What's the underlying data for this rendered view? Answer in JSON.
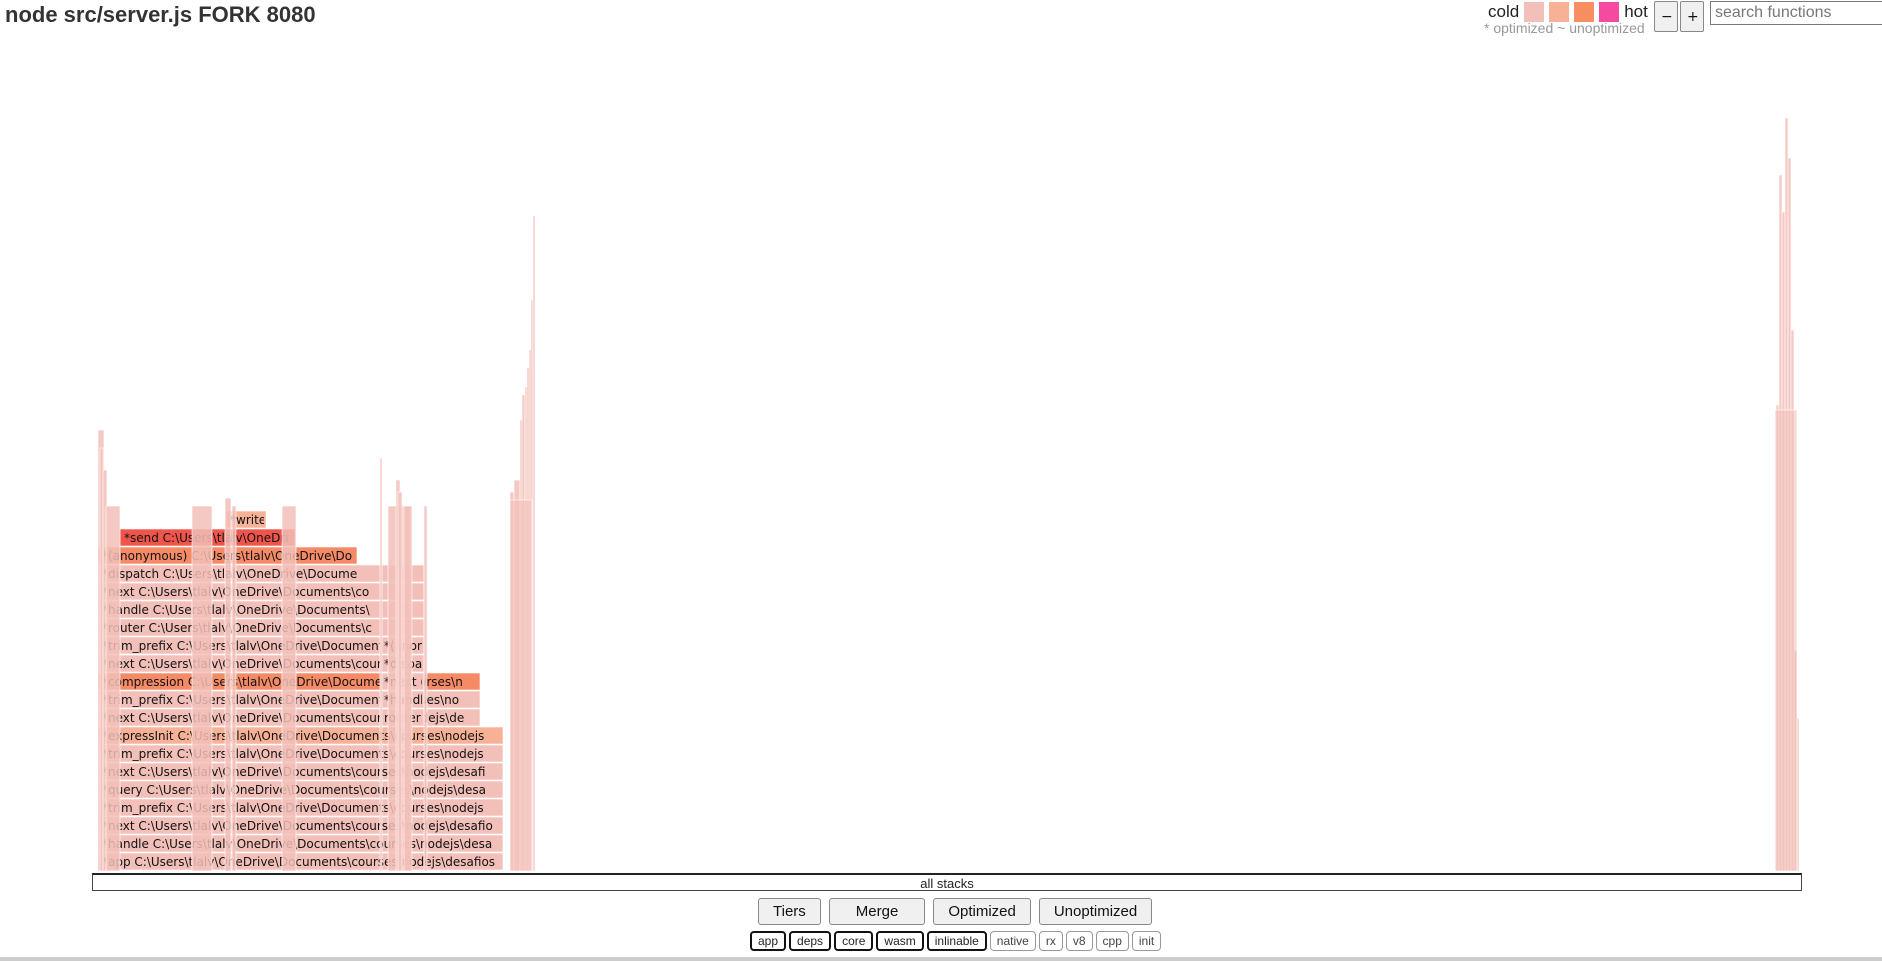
{
  "header": {
    "title": "node src/server.js FORK 8080",
    "legend": {
      "cold_label": "cold",
      "hot_label": "hot",
      "swatches": [
        "#f2c0b8",
        "#f6b196",
        "#f88d62",
        "#f64aa0"
      ],
      "opt_note": "* optimized ~ unoptimized"
    },
    "zoom_out_label": "−",
    "zoom_in_label": "+",
    "search_placeholder": "search functions"
  },
  "flamegraph": {
    "root_label": "all stacks",
    "colors": {
      "cold": "#f2c0b8",
      "warm": "#f6b196",
      "hotter": "#f58a66",
      "hottest": "#f0554c"
    },
    "frames": [
      {
        "name": "app-frame",
        "label": "*app C:\\Users\\tlalv\\OneDrive\\Documents\\courses\\nodejs\\desafios",
        "heat": "cold"
      },
      {
        "name": "handle-frame",
        "label": "*handle C:\\Users\\tlalv\\OneDrive\\Documents\\courses\\nodejs\\desa",
        "heat": "cold"
      },
      {
        "name": "next-frame",
        "label": "*next C:\\Users\\tlalv\\OneDrive\\Documents\\courses\\nodejs\\desafio",
        "heat": "cold"
      },
      {
        "name": "trim-prefix-frame",
        "label": "*trim_prefix C:\\Users\\tlalv\\OneDrive\\Documents\\courses\\nodejs",
        "heat": "cold"
      },
      {
        "name": "query-frame",
        "label": "*query C:\\Users\\tlalv\\OneDrive\\Documents\\courses\\nodejs\\desa",
        "heat": "cold"
      },
      {
        "name": "next-frame",
        "label": "*next C:\\Users\\tlalv\\OneDrive\\Documents\\courses\\nodejs\\desafi",
        "heat": "cold"
      },
      {
        "name": "trim-prefix-frame",
        "label": "*trim_prefix C:\\Users\\tlalv\\OneDrive\\Documents\\courses\\nodejs",
        "heat": "cold"
      },
      {
        "name": "express-init-frame",
        "label": "*expressInit C:\\Users\\tlalv\\OneDrive\\Documents\\courses\\nodejs",
        "heat": "warm"
      },
      {
        "name": "next-frame",
        "label": "*next C:\\Users\\tlalv\\OneDrive\\Documents\\courses\\nodejs\\de",
        "heat": "cold"
      },
      {
        "name": "trim-prefix-frame",
        "label": "*trim_prefix C:\\Users\\tlalv\\OneDrive\\Documents\\courses\\no",
        "heat": "cold"
      },
      {
        "name": "compression-frame",
        "label": "*compression C:\\Users\\tlalv\\OneDrive\\Documents\\courses\\n",
        "heat": "hotter"
      },
      {
        "name": "next-frame",
        "label": "*next C:\\Users\\tlalv\\OneDrive\\Documents\\courses\\n",
        "heat": "cold"
      },
      {
        "name": "trim-prefix-frame",
        "label": "*trim_prefix C:\\Users\\tlalv\\OneDrive\\Documents\\cou",
        "heat": "cold"
      },
      {
        "name": "router-frame",
        "label": "*router C:\\Users\\tlalv\\OneDrive\\Documents\\c",
        "heat": "cold"
      },
      {
        "name": "handle-frame",
        "label": "*handle C:\\Users\\tlalv\\OneDrive\\Documents\\",
        "heat": "cold"
      },
      {
        "name": "next-frame",
        "label": "*next C:\\Users\\tlalv\\OneDrive\\Documents\\co",
        "heat": "cold"
      },
      {
        "name": "dispatch-frame",
        "label": "*dispatch C:\\Users\\tlalv\\OneDrive\\Docume",
        "heat": "cold"
      },
      {
        "name": "anonymous-frame",
        "label": "*(anonymous) C:\\Users\\tlalv\\OneDrive\\Do",
        "heat": "hotter"
      },
      {
        "name": "send-frame",
        "label": "*send C:\\Users\\tlalv\\OneDri",
        "heat": "hottest"
      },
      {
        "name": "write-frame",
        "label": "*write",
        "heat": "warm"
      },
      {
        "name": "anonymous-frame",
        "label": "*(anon",
        "heat": "cold"
      },
      {
        "name": "dispatch-frame",
        "label": "*dispa",
        "heat": "cold"
      },
      {
        "name": "next-frame",
        "label": "*next (",
        "heat": "cold"
      },
      {
        "name": "handle-frame",
        "label": "*handl",
        "heat": "cold"
      },
      {
        "name": "router-frame",
        "label": "router",
        "heat": "cold"
      }
    ]
  },
  "controls": {
    "buttons": [
      "Tiers",
      "Merge",
      "Optimized",
      "Unoptimized"
    ]
  },
  "filters": [
    {
      "label": "app",
      "on": true
    },
    {
      "label": "deps",
      "on": true
    },
    {
      "label": "core",
      "on": true
    },
    {
      "label": "wasm",
      "on": true
    },
    {
      "label": "inlinable",
      "on": true
    },
    {
      "label": "native",
      "on": false
    },
    {
      "label": "rx",
      "on": false
    },
    {
      "label": "v8",
      "on": false
    },
    {
      "label": "cpp",
      "on": false
    },
    {
      "label": "init",
      "on": false
    }
  ]
}
